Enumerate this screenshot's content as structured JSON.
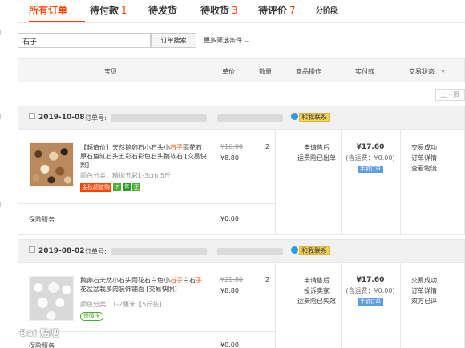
{
  "tabs": [
    {
      "label": "所有订单",
      "count": ""
    },
    {
      "label": "待付款",
      "count": "1"
    },
    {
      "label": "待发货",
      "count": ""
    },
    {
      "label": "待收货",
      "count": "3"
    },
    {
      "label": "待评价",
      "count": "7"
    },
    {
      "label": "分阶段",
      "count": ""
    }
  ],
  "search": {
    "value": "石子",
    "button": "订单搜索",
    "more_filters": "更多筛选条件"
  },
  "table_header": {
    "item": "宝贝",
    "unit_price": "单价",
    "qty": "数量",
    "ops": "商品操作",
    "paid": "实付款",
    "status": "交易状态"
  },
  "pager": {
    "prev": "上一页"
  },
  "orders": [
    {
      "date": "2019-10-08",
      "order_no_label": "订单号:",
      "contact": "和我联系",
      "title_pre": "【超值价】天然鹅卵石小石头小",
      "title_hl": "石子",
      "title_post": "雨花石原石鱼缸石头五彩石彩色石头鹅软石 [交易快照]",
      "attr": "颜色分类：精抛五彩1-3cm 5斤",
      "tag_red": "金秋超值购",
      "tag_green": "7",
      "tag_dark": "保",
      "tag_zheng": "正",
      "price_old": "¥16.00",
      "price_new": "¥8.80",
      "qty": "2",
      "ops": [
        "申请售后",
        "运费险已出单"
      ],
      "paid": "¥17.60",
      "shipping": "(含运费：¥0.00)",
      "mobile": "手机订单",
      "status": [
        "交易成功",
        "订单详情",
        "查看物流"
      ],
      "service_label": "保险服务",
      "service_price": "¥0.00"
    },
    {
      "date": "2019-08-02",
      "order_no_label": "订单号:",
      "contact": "和我联系",
      "title_pre": "鹅卵石天然小石头雨花石白色小",
      "title_hl": "石子",
      "title_mid": "白石",
      "title_hl2": "子",
      "title_post": "花盆盆栽多肉装饰铺面 [交易快照]",
      "attr": "颜色分类：1-2厘米【5斤装】",
      "tag_ins": "保障卡",
      "price_old": "¥21.80",
      "price_new": "¥8.80",
      "qty": "2",
      "ops": [
        "申请售后",
        "投诉卖家",
        "运费险已失效"
      ],
      "paid": "¥17.60",
      "shipping": "(含运费：¥0.00)",
      "mobile": "手机订单",
      "status": [
        "交易成功",
        "订单详情",
        "双方已评"
      ],
      "service_label": "保险服务",
      "service_price": "¥0.00"
    }
  ],
  "watermark": "Bai 贴吧",
  "colors": {
    "accent": "#ff4400",
    "header_bg": "#f5f5f5",
    "order_head_bg": "#f1f1f1",
    "mobile_tag": "#5f9de0"
  }
}
